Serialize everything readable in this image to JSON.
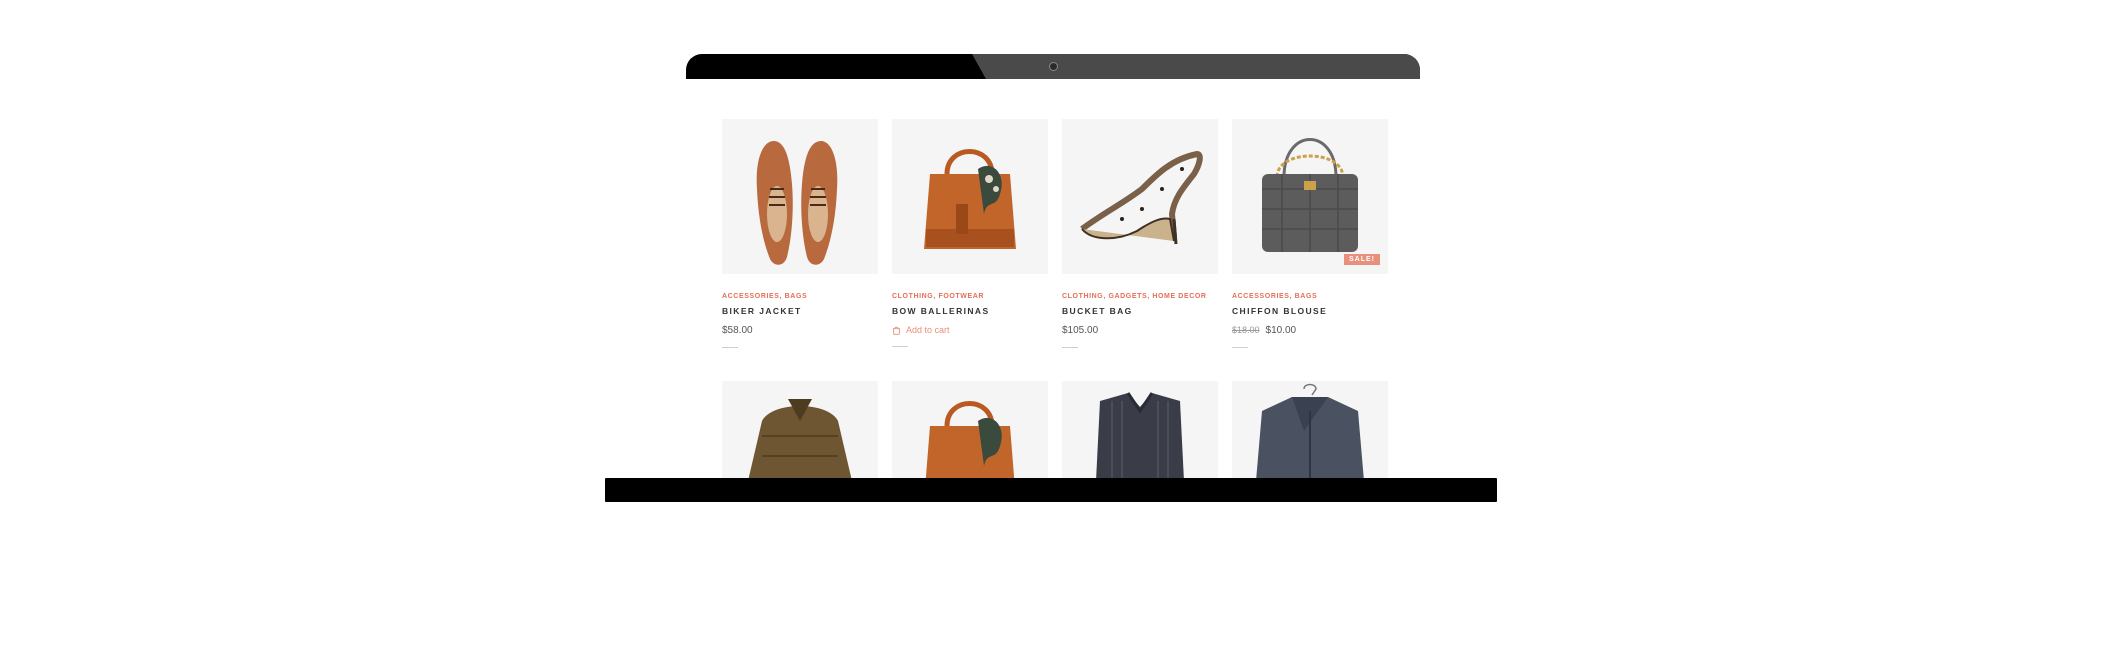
{
  "products": [
    {
      "categories": "Accessories, Bags",
      "title": "Biker Jacket",
      "price": "$58.00"
    },
    {
      "categories": "Clothing, Footwear",
      "title": "Bow Ballerinas",
      "cart_label": "Add to cart"
    },
    {
      "categories": "Clothing, Gadgets, Home Decor",
      "title": "Bucket Bag",
      "price": "$105.00"
    },
    {
      "categories": "Accessories, Bags",
      "title": "Chiffon Blouse",
      "old_price": "$18.00",
      "price": "$10.00",
      "badge": "Sale!"
    }
  ],
  "icons": {
    "cart": "shopping-bag-icon"
  },
  "colors": {
    "accent": "#e46f59",
    "badge": "#e8907c",
    "frame": "#000000",
    "frame_highlight": "#4a4a4a"
  }
}
